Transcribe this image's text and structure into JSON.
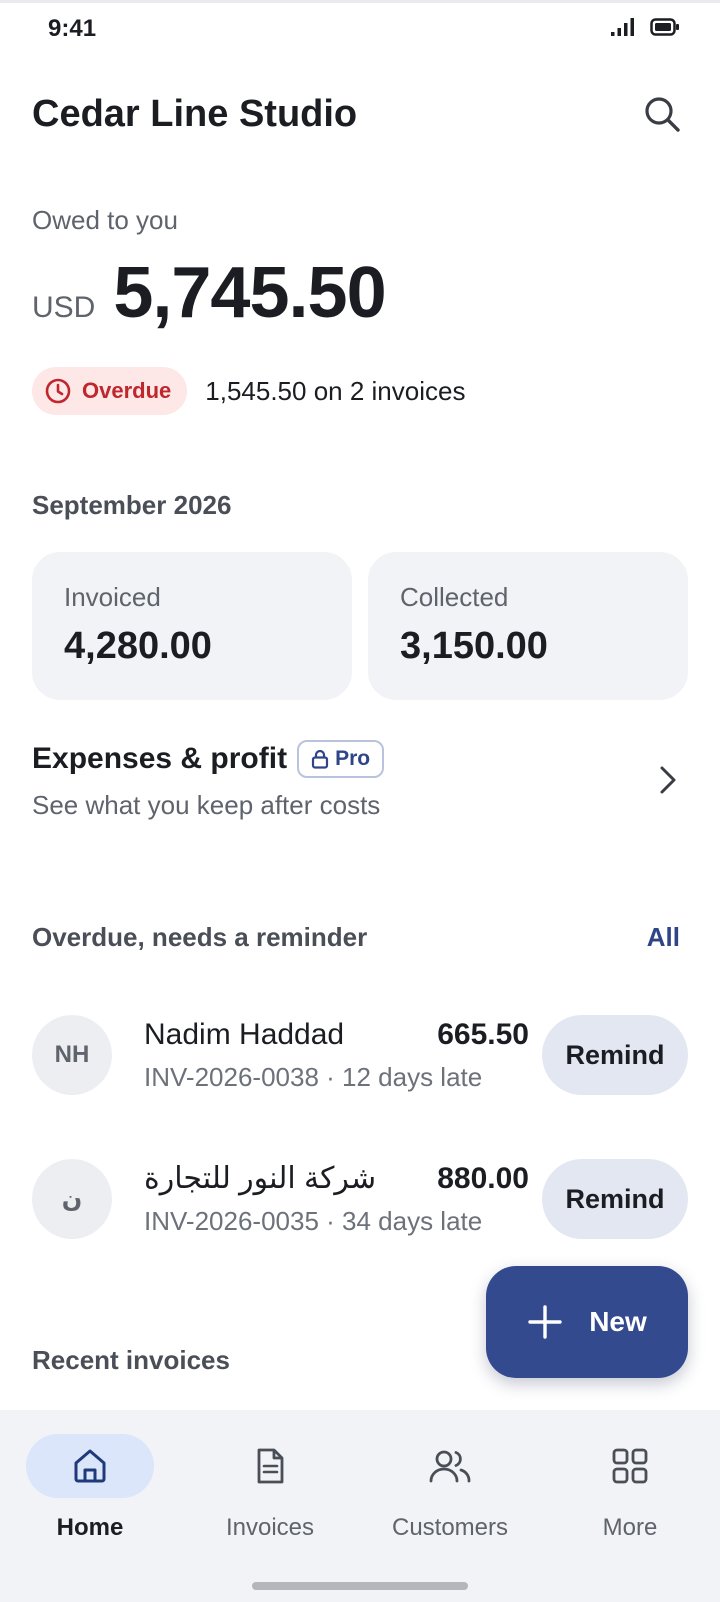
{
  "status_bar": {
    "time": "9:41"
  },
  "header": {
    "title": "Cedar Line Studio"
  },
  "summary": {
    "label": "Owed to you",
    "currency": "USD",
    "amount": "5,745.50",
    "overdue_badge": "Overdue",
    "overdue_summary": "1,545.50 on 2 invoices"
  },
  "month": {
    "title": "September 2026",
    "invoiced_label": "Invoiced",
    "invoiced_value": "4,280.00",
    "collected_label": "Collected",
    "collected_value": "3,150.00"
  },
  "expenses": {
    "title": "Expenses & profit",
    "badge": "Pro",
    "subtitle": "See what you keep after costs"
  },
  "overdue_section": {
    "title": "Overdue, needs a reminder",
    "link": "All",
    "items": [
      {
        "initials": "NH",
        "name": "Nadim Haddad",
        "amount": "665.50",
        "meta": "INV-2026-0038 · 12 days late",
        "action": "Remind"
      },
      {
        "initials": "ن",
        "name": "شركة النور للتجارة",
        "amount": "880.00",
        "meta": "INV-2026-0035 · 34 days late",
        "action": "Remind"
      }
    ]
  },
  "recent": {
    "title": "Recent invoices"
  },
  "fab": {
    "label": "New"
  },
  "nav": {
    "items": [
      {
        "label": "Home",
        "icon": "home-icon",
        "active": true
      },
      {
        "label": "Invoices",
        "icon": "document-icon",
        "active": false
      },
      {
        "label": "Customers",
        "icon": "people-icon",
        "active": false
      },
      {
        "label": "More",
        "icon": "grid-icon",
        "active": false
      }
    ]
  },
  "colors": {
    "accent": "#344a8e",
    "overdue_bg": "#fde7e7",
    "overdue_text": "#c0262d",
    "nav_active_bg": "#dbe6fb"
  }
}
